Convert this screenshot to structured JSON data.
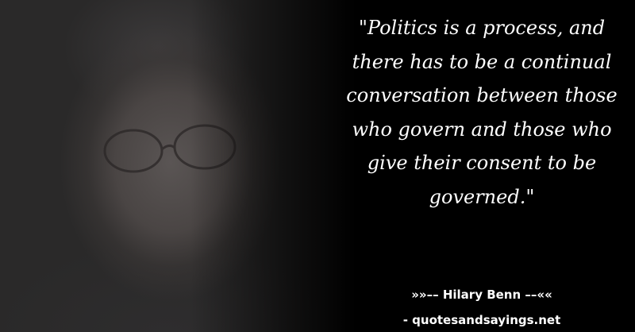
{
  "quote": {
    "text": "\"Politics is a process, and there has to be a continual conversation between those who govern and those who give their consent to be governed.\"",
    "author_line": "»»–– Hilary Benn ––««",
    "source": "- quotesandsayings.net"
  },
  "colors": {
    "background": "#000000",
    "text": "#ffffff"
  }
}
